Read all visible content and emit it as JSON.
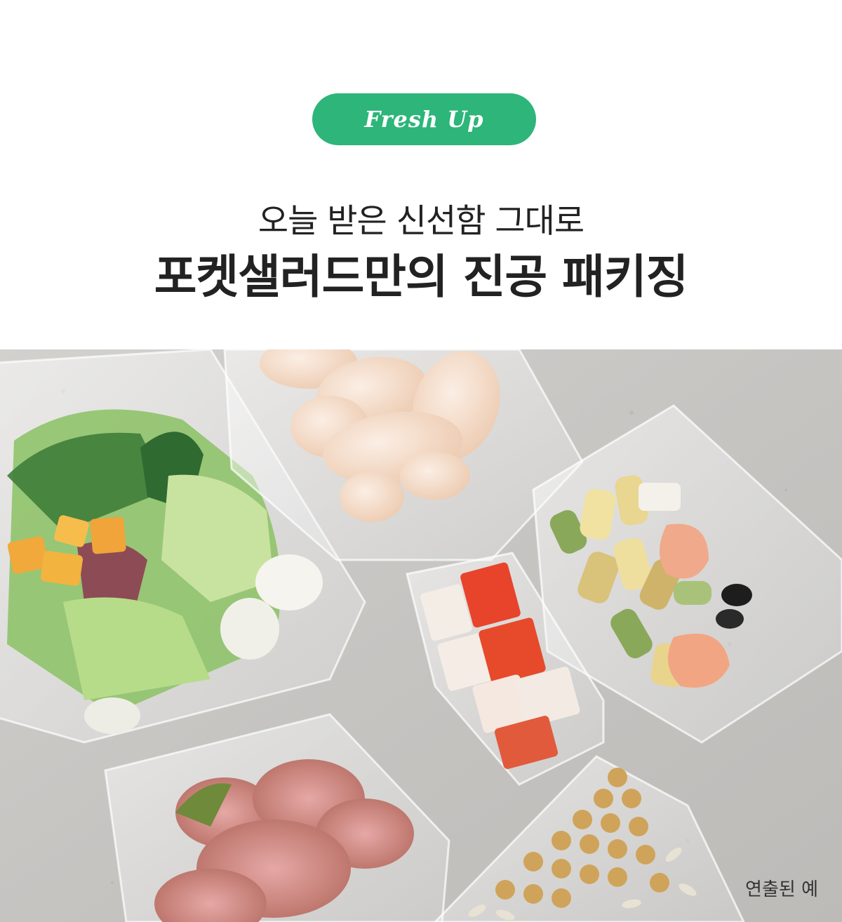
{
  "badge": {
    "label": "Fresh Up",
    "background": "#2db57a"
  },
  "headline": {
    "subtitle": "오늘 받은 신선함 그대로",
    "title": "포켓샐러드만의 진공 패키징"
  },
  "photo": {
    "caption": "연출된 예"
  }
}
